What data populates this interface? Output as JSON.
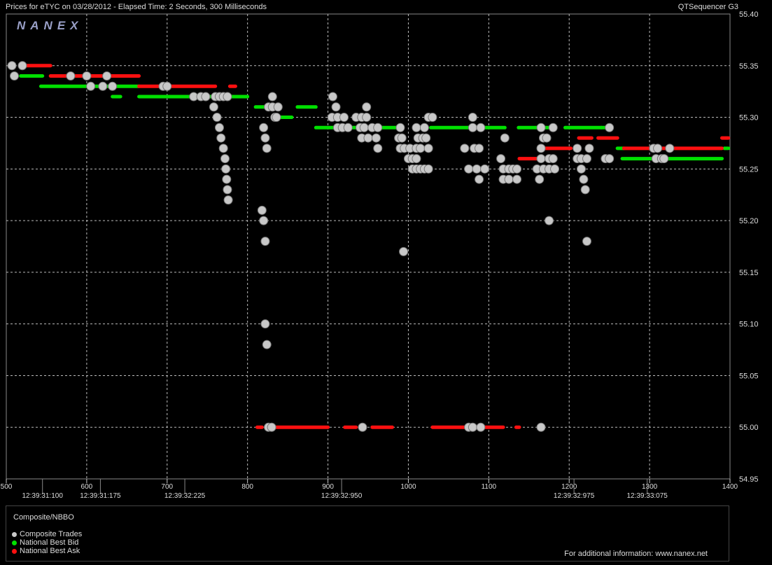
{
  "header": {
    "title": "Prices for  eTYC  on  03/28/2012  -  Elapsed Time: 2 Seconds, 300 Milliseconds",
    "app": "QTSequencer G3"
  },
  "logo": "NANEX",
  "legend": {
    "heading": "Composite/NBBO",
    "items": [
      {
        "label": "Composite Trades",
        "color": "#c8c8c8"
      },
      {
        "label": "National Best Bid",
        "color": "#00e000"
      },
      {
        "label": "National Best Ask",
        "color": "#ff1010"
      }
    ],
    "info": "For additional information: www.nanex.net"
  },
  "chart_data": {
    "type": "scatter",
    "xlim": [
      500,
      1400
    ],
    "ylim": [
      54.95,
      55.4
    ],
    "x_ticks": [
      500,
      600,
      700,
      800,
      900,
      1000,
      1100,
      1200,
      1300,
      1400
    ],
    "x_tick_labels": [
      "500",
      "600",
      "700",
      "800",
      "900",
      "1000",
      "1100",
      "1200",
      "1300",
      "1400"
    ],
    "y_ticks": [
      54.95,
      55.0,
      55.05,
      55.1,
      55.15,
      55.2,
      55.25,
      55.3,
      55.35,
      55.4
    ],
    "y_tick_labels": [
      "54.95",
      "55.00",
      "55.05",
      "55.10",
      "55.15",
      "55.20",
      "55.25",
      "55.30",
      "55.35",
      "55.40"
    ],
    "time_labels": [
      {
        "x": 545,
        "label": "12:39:31:100"
      },
      {
        "x": 617,
        "label": "12:39:31:175"
      },
      {
        "x": 722,
        "label": "12:39:32:225"
      },
      {
        "x": 917,
        "label": "12:39:32:950"
      },
      {
        "x": 1206,
        "label": "12:39:32:975"
      },
      {
        "x": 1297,
        "label": "12:39:33:075"
      }
    ],
    "grid": true,
    "series": [
      {
        "name": "National Best Bid",
        "color": "#00e000",
        "segments": [
          [
            518,
            545,
            55.34
          ],
          [
            543,
            665,
            55.33
          ],
          [
            632,
            642,
            55.32
          ],
          [
            665,
            800,
            55.32
          ],
          [
            810,
            822,
            55.31
          ],
          [
            839,
            855,
            55.3
          ],
          [
            862,
            885,
            55.31
          ],
          [
            885,
            990,
            55.29
          ],
          [
            1028,
            1090,
            55.29
          ],
          [
            1090,
            1120,
            55.29
          ],
          [
            1137,
            1177,
            55.29
          ],
          [
            1195,
            1240,
            55.29
          ],
          [
            1240,
            1250,
            55.29
          ],
          [
            1260,
            1268,
            55.27
          ],
          [
            1266,
            1390,
            55.26
          ],
          [
            1393,
            1398,
            55.27
          ]
        ]
      },
      {
        "name": "National Best Ask",
        "color": "#ff1010",
        "segments": [
          [
            520,
            555,
            55.35
          ],
          [
            555,
            665,
            55.34
          ],
          [
            665,
            760,
            55.33
          ],
          [
            778,
            785,
            55.33
          ],
          [
            812,
            818,
            55.0
          ],
          [
            834,
            900,
            55.0
          ],
          [
            921,
            935,
            55.0
          ],
          [
            955,
            980,
            55.0
          ],
          [
            1030,
            1118,
            55.0
          ],
          [
            1134,
            1138,
            55.0
          ],
          [
            1138,
            1160,
            55.26
          ],
          [
            1162,
            1202,
            55.27
          ],
          [
            1212,
            1228,
            55.28
          ],
          [
            1236,
            1260,
            55.28
          ],
          [
            1268,
            1390,
            55.27
          ],
          [
            1390,
            1398,
            55.28
          ]
        ]
      },
      {
        "name": "Composite Trades",
        "color": "#c8c8c8",
        "points": [
          [
            507,
            55.35
          ],
          [
            520,
            55.35
          ],
          [
            510,
            55.34
          ],
          [
            580,
            55.34
          ],
          [
            600,
            55.34
          ],
          [
            625,
            55.34
          ],
          [
            605,
            55.33
          ],
          [
            620,
            55.33
          ],
          [
            632,
            55.33
          ],
          [
            695,
            55.33
          ],
          [
            700,
            55.33
          ],
          [
            733,
            55.32
          ],
          [
            742,
            55.32
          ],
          [
            748,
            55.32
          ],
          [
            760,
            55.32
          ],
          [
            765,
            55.32
          ],
          [
            770,
            55.32
          ],
          [
            775,
            55.32
          ],
          [
            758,
            55.31
          ],
          [
            762,
            55.3
          ],
          [
            765,
            55.29
          ],
          [
            767,
            55.28
          ],
          [
            770,
            55.27
          ],
          [
            772,
            55.26
          ],
          [
            773,
            55.25
          ],
          [
            774,
            55.24
          ],
          [
            775,
            55.23
          ],
          [
            776,
            55.22
          ],
          [
            831,
            55.32
          ],
          [
            826,
            55.31
          ],
          [
            831,
            55.31
          ],
          [
            838,
            55.31
          ],
          [
            834,
            55.3
          ],
          [
            836,
            55.3
          ],
          [
            820,
            55.29
          ],
          [
            822,
            55.28
          ],
          [
            824,
            55.27
          ],
          [
            818,
            55.21
          ],
          [
            820,
            55.2
          ],
          [
            822,
            55.18
          ],
          [
            822,
            55.1
          ],
          [
            824,
            55.08
          ],
          [
            826,
            55.0
          ],
          [
            830,
            55.0
          ],
          [
            906,
            55.32
          ],
          [
            910,
            55.31
          ],
          [
            905,
            55.3
          ],
          [
            912,
            55.3
          ],
          [
            920,
            55.3
          ],
          [
            935,
            55.3
          ],
          [
            912,
            55.29
          ],
          [
            918,
            55.29
          ],
          [
            925,
            55.29
          ],
          [
            948,
            55.31
          ],
          [
            942,
            55.3
          ],
          [
            948,
            55.3
          ],
          [
            940,
            55.29
          ],
          [
            945,
            55.29
          ],
          [
            955,
            55.29
          ],
          [
            962,
            55.29
          ],
          [
            942,
            55.28
          ],
          [
            950,
            55.28
          ],
          [
            960,
            55.28
          ],
          [
            962,
            55.27
          ],
          [
            990,
            55.29
          ],
          [
            1010,
            55.29
          ],
          [
            1020,
            55.29
          ],
          [
            1025,
            55.3
          ],
          [
            1030,
            55.3
          ],
          [
            988,
            55.28
          ],
          [
            992,
            55.28
          ],
          [
            1012,
            55.28
          ],
          [
            1018,
            55.28
          ],
          [
            1022,
            55.28
          ],
          [
            990,
            55.27
          ],
          [
            995,
            55.27
          ],
          [
            1002,
            55.27
          ],
          [
            1010,
            55.27
          ],
          [
            1015,
            55.27
          ],
          [
            1025,
            55.27
          ],
          [
            1000,
            55.26
          ],
          [
            1005,
            55.26
          ],
          [
            1010,
            55.26
          ],
          [
            1005,
            55.25
          ],
          [
            1010,
            55.25
          ],
          [
            1015,
            55.25
          ],
          [
            1020,
            55.25
          ],
          [
            1025,
            55.25
          ],
          [
            994,
            55.17
          ],
          [
            943,
            55.0
          ],
          [
            1080,
            55.3
          ],
          [
            1080,
            55.29
          ],
          [
            1090,
            55.29
          ],
          [
            1070,
            55.27
          ],
          [
            1082,
            55.27
          ],
          [
            1088,
            55.27
          ],
          [
            1075,
            55.25
          ],
          [
            1085,
            55.25
          ],
          [
            1095,
            55.25
          ],
          [
            1088,
            55.24
          ],
          [
            1120,
            55.28
          ],
          [
            1115,
            55.26
          ],
          [
            1118,
            55.25
          ],
          [
            1125,
            55.25
          ],
          [
            1130,
            55.25
          ],
          [
            1135,
            55.25
          ],
          [
            1118,
            55.24
          ],
          [
            1125,
            55.24
          ],
          [
            1135,
            55.24
          ],
          [
            1075,
            55.0
          ],
          [
            1080,
            55.0
          ],
          [
            1090,
            55.0
          ],
          [
            1165,
            55.29
          ],
          [
            1180,
            55.29
          ],
          [
            1168,
            55.28
          ],
          [
            1172,
            55.28
          ],
          [
            1165,
            55.27
          ],
          [
            1165,
            55.26
          ],
          [
            1175,
            55.26
          ],
          [
            1180,
            55.26
          ],
          [
            1160,
            55.25
          ],
          [
            1168,
            55.25
          ],
          [
            1175,
            55.25
          ],
          [
            1182,
            55.25
          ],
          [
            1163,
            55.24
          ],
          [
            1175,
            55.2
          ],
          [
            1165,
            55.0
          ],
          [
            1210,
            55.27
          ],
          [
            1225,
            55.27
          ],
          [
            1210,
            55.26
          ],
          [
            1215,
            55.26
          ],
          [
            1222,
            55.26
          ],
          [
            1215,
            55.25
          ],
          [
            1218,
            55.24
          ],
          [
            1220,
            55.23
          ],
          [
            1222,
            55.18
          ],
          [
            1250,
            55.29
          ],
          [
            1245,
            55.26
          ],
          [
            1250,
            55.26
          ],
          [
            1305,
            55.27
          ],
          [
            1310,
            55.27
          ],
          [
            1325,
            55.27
          ],
          [
            1308,
            55.26
          ],
          [
            1315,
            55.26
          ],
          [
            1318,
            55.26
          ]
        ]
      }
    ]
  }
}
